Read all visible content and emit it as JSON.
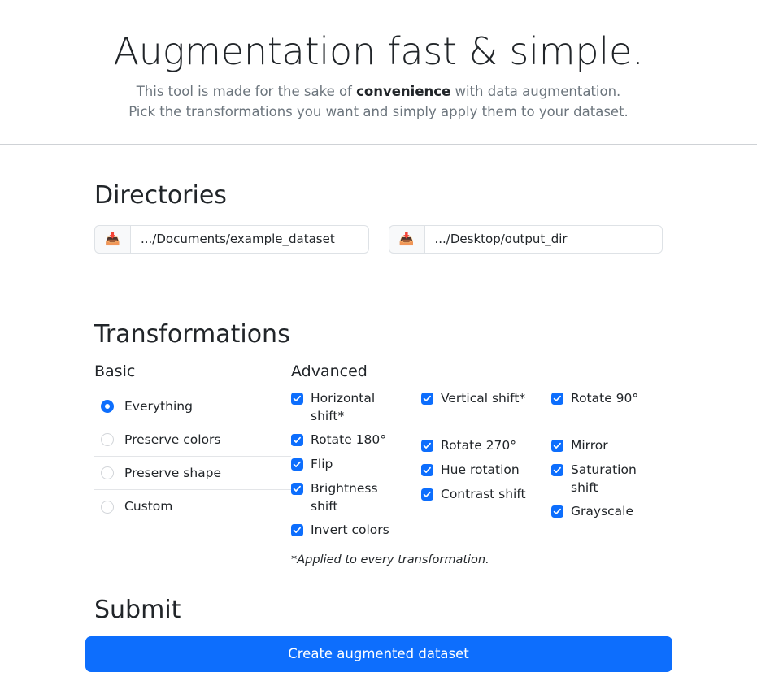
{
  "hero": {
    "title": "Augmentation fast & simple.",
    "subtitle_line1_before": "This tool is made for the sake of ",
    "subtitle_emphasis": "convenience",
    "subtitle_line1_after": " with data augmentation.",
    "subtitle_line2": "Pick the transformations you want and simply apply them to your dataset."
  },
  "directories": {
    "title": "Directories",
    "inputs": [
      {
        "icon": "inbox-tray-icon",
        "glyph": "📥",
        "value": ".../Documents/example_dataset",
        "placeholder": ".../Documents/example_dataset"
      },
      {
        "icon": "inbox-tray-icon",
        "glyph": "📥",
        "value": ".../Desktop/output_dir",
        "placeholder": ".../Desktop/output_dir"
      }
    ]
  },
  "transformations": {
    "title": "Transformations",
    "basic": {
      "title": "Basic",
      "options": [
        {
          "label": "Everything",
          "checked": true
        },
        {
          "label": "Preserve colors",
          "checked": false
        },
        {
          "label": "Preserve shape",
          "checked": false
        },
        {
          "label": "Custom",
          "checked": false
        }
      ]
    },
    "advanced": {
      "title": "Advanced",
      "columns": [
        [
          {
            "label": "Horizontal shift*",
            "checked": true
          },
          {
            "label": "Rotate 180°",
            "checked": true
          },
          {
            "label": "Flip",
            "checked": true
          },
          {
            "label": "Brightness shift",
            "checked": true
          },
          {
            "label": "Invert colors",
            "checked": true
          }
        ],
        [
          {
            "label": "Vertical shift*",
            "checked": true
          },
          {
            "label": "Rotate 270°",
            "checked": true
          },
          {
            "label": "Hue rotation",
            "checked": true
          },
          {
            "label": "Contrast shift",
            "checked": true
          }
        ],
        [
          {
            "label": "Rotate 90°",
            "checked": true
          },
          {
            "label": "Mirror",
            "checked": true
          },
          {
            "label": "Saturation shift",
            "checked": true
          },
          {
            "label": "Grayscale",
            "checked": true
          }
        ]
      ],
      "footnote": "*Applied to every transformation."
    }
  },
  "submit": {
    "title": "Submit",
    "button_label": "Create augmented dataset"
  },
  "colors": {
    "accent": "#0d6efd",
    "muted_text": "#6c757d",
    "border": "#dee2e6",
    "divider": "#e3e5e8"
  }
}
